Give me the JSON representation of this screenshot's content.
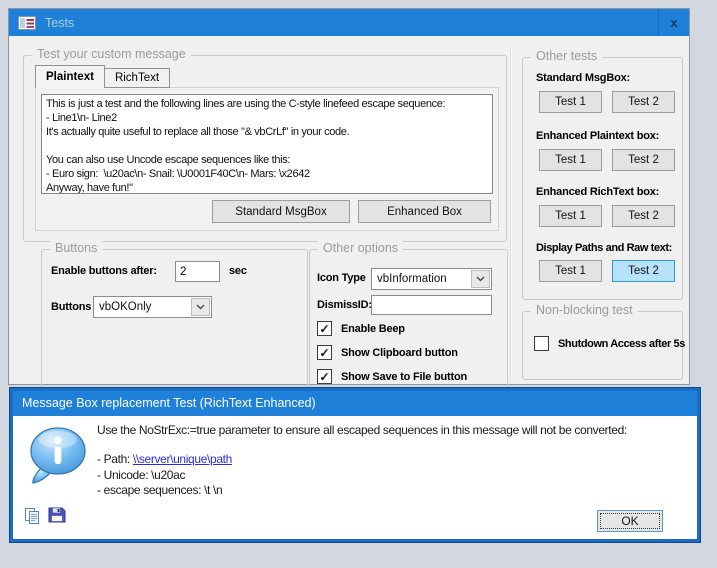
{
  "colors": {
    "titlebar_blue": "#1e80d8",
    "dialog_border_blue": "#1b6dc1",
    "hover_button_fill": "#b7e2fb",
    "hover_button_border": "#2f96d8",
    "link_blue": "#2a2ae0",
    "desktop_background": "#d3d8e0"
  },
  "window": {
    "title": "Tests",
    "close_glyph": "x",
    "message_group": {
      "label": "Test your custom message",
      "tabs": [
        {
          "label": "Plaintext"
        },
        {
          "label": "RichText"
        }
      ],
      "text": "This is just a test and the following lines are using the C-style linefeed escape sequence:\n- Line1\\n- Line2\nIt's actually quite useful to replace all those \"& vbCrLf\" in your code.\n\nYou can also use Uncode escape sequences like this:\n- Euro sign:  \\u20ac\\n- Snail: \\U0001F40C\\n- Mars: \\x2642\nAnyway, have fun!\"",
      "standard_button": "Standard MsgBox",
      "enhanced_button": "Enhanced Box"
    },
    "buttons_group": {
      "label": "Buttons",
      "enable_label": "Enable buttons after:",
      "enable_value": "2",
      "unit": "sec",
      "combo_label": "Buttons",
      "combo_value": "vbOKOnly"
    },
    "options_group": {
      "label": "Other options",
      "icon_type_label": "Icon Type",
      "icon_type_value": "vbInformation",
      "dismiss_label": "DismissID:",
      "dismiss_value": "",
      "checks": [
        {
          "label": "Enable Beep",
          "glyph": "✓"
        },
        {
          "label": "Show Clipboard button",
          "glyph": "✓"
        },
        {
          "label": "Show Save to File button",
          "glyph": "✓"
        }
      ]
    },
    "other_tests_group": {
      "label": "Other tests",
      "sections": [
        {
          "label": "Standard MsgBox:",
          "test1": "Test 1",
          "test2": "Test 2"
        },
        {
          "label": "Enhanced Plaintext box:",
          "test1": "Test 1",
          "test2": "Test 2"
        },
        {
          "label": "Enhanced RichText box:",
          "test1": "Test 1",
          "test2": "Test 2"
        },
        {
          "label": "Display Paths and Raw text:",
          "test1": "Test 1",
          "test2": "Test 2"
        }
      ]
    },
    "nonblocking_group": {
      "label": "Non-blocking test",
      "check": {
        "label": "Shutdown Access after 5s",
        "glyph": ""
      }
    }
  },
  "msgbox": {
    "title": "Message Box replacement Test (RichText Enhanced)",
    "intro": "Use the NoStrExc:=true parameter to ensure all escaped sequences in this message will not be converted:",
    "path_prefix": "- Path: ",
    "path_link": "\\\\server\\unique\\path",
    "unicode_line": "- Unicode: \\u20ac",
    "escape_line": "- escape sequences: \\t \\n",
    "ok_label": "OK"
  }
}
